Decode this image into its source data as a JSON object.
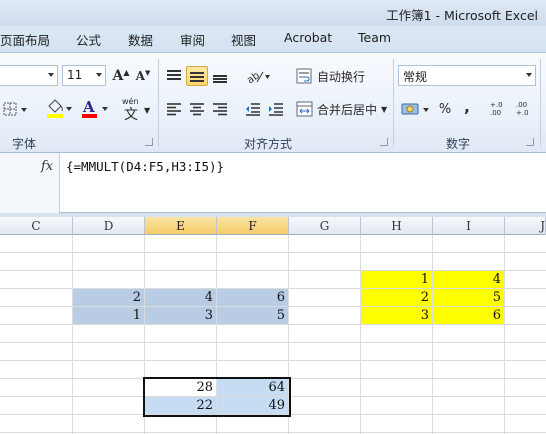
{
  "window": {
    "title": "工作簿1 - Microsoft Excel"
  },
  "tabs": [
    "页面布局",
    "公式",
    "数据",
    "审阅",
    "视图",
    "Acrobat",
    "Team"
  ],
  "ribbon": {
    "font_group": {
      "label": "字体",
      "size_value": "11",
      "grow_glyph": "A",
      "shrink_glyph": "A",
      "font_color_glyph": "A",
      "phonetic_glyph": "文"
    },
    "align_group": {
      "label": "对齐方式",
      "wrap_text": "自动换行",
      "merge_center": "合并后居中"
    },
    "number_group": {
      "label": "数字",
      "format_value": "常规",
      "percent": "%",
      "comma": ",",
      "inc_decimal": "+.0 .00",
      "dec_decimal": ".00 +.0"
    }
  },
  "formula_bar": {
    "fx_label": "fx",
    "formula": "{=MMULT(D4:F5,H3:I5)}"
  },
  "columns": [
    "C",
    "D",
    "E",
    "F",
    "G",
    "H",
    "I",
    "J"
  ],
  "active_columns": [
    "E",
    "F"
  ],
  "cells": {
    "matrix_a": [
      [
        "2",
        "4",
        "6"
      ],
      [
        "1",
        "3",
        "5"
      ]
    ],
    "matrix_b": [
      [
        "1",
        "4"
      ],
      [
        "2",
        "5"
      ],
      [
        "3",
        "6"
      ]
    ],
    "result": [
      [
        "28",
        "64"
      ],
      [
        "22",
        "49"
      ]
    ]
  },
  "colors": {
    "matrix_a_fill": "#b8cce4",
    "matrix_b_fill": "#ffff00",
    "selection_fill": "#c6dcf3"
  }
}
